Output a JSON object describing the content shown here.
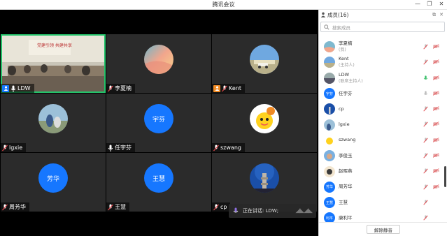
{
  "window": {
    "title": "腾讯会议"
  },
  "tiles": [
    {
      "name": "LDW",
      "kind": "video",
      "host": "blue"
    },
    {
      "name": "李夏楠",
      "kind": "image",
      "initials": ""
    },
    {
      "name": "Kent",
      "kind": "image",
      "host": "orange"
    },
    {
      "name": "lgxie",
      "kind": "image"
    },
    {
      "name": "任宇芬",
      "kind": "blue",
      "initials": "宇芬"
    },
    {
      "name": "szwang",
      "kind": "image"
    },
    {
      "name": "周芳华",
      "kind": "blue",
      "initials": "芳华"
    },
    {
      "name": "王慧",
      "kind": "blue",
      "initials": "王慧"
    },
    {
      "name": "cp",
      "kind": "image"
    }
  ],
  "speaking": {
    "label": "正在讲话: LDW;"
  },
  "panel": {
    "title": "成员(16)",
    "search_placeholder": "搜索成员",
    "unmute_all": "解除静音",
    "members": [
      {
        "name": "李夏楠",
        "role": "(我)",
        "avatar": "image",
        "mic": "muted"
      },
      {
        "name": "Kent",
        "role": "(主持人)",
        "avatar": "image",
        "mic": "muted"
      },
      {
        "name": "LDW",
        "role": "(联席主持人)",
        "avatar": "image",
        "mic": "on"
      },
      {
        "name": "任宇芬",
        "role": "",
        "avatar": "blue",
        "initials": "宇芬",
        "mic": "muted-gray"
      },
      {
        "name": "cp",
        "role": "",
        "avatar": "image",
        "mic": "muted"
      },
      {
        "name": "lgxie",
        "role": "",
        "avatar": "image",
        "mic": "muted"
      },
      {
        "name": "szwang",
        "role": "",
        "avatar": "image",
        "mic": "muted"
      },
      {
        "name": "李俊玉",
        "role": "",
        "avatar": "image",
        "mic": "muted"
      },
      {
        "name": "赵晖燕",
        "role": "",
        "avatar": "image",
        "mic": "muted"
      },
      {
        "name": "周芳华",
        "role": "",
        "avatar": "blue",
        "initials": "芳华",
        "mic": "muted"
      },
      {
        "name": "王慧",
        "role": "",
        "avatar": "blue",
        "initials": "王慧",
        "mic": "muted"
      },
      {
        "name": "康利平",
        "role": "",
        "avatar": "blue",
        "initials": "利平",
        "mic": "muted"
      }
    ]
  },
  "colors": {
    "accent": "#1677ff",
    "active_border": "#23c36a",
    "muted_red": "#e5484d"
  }
}
